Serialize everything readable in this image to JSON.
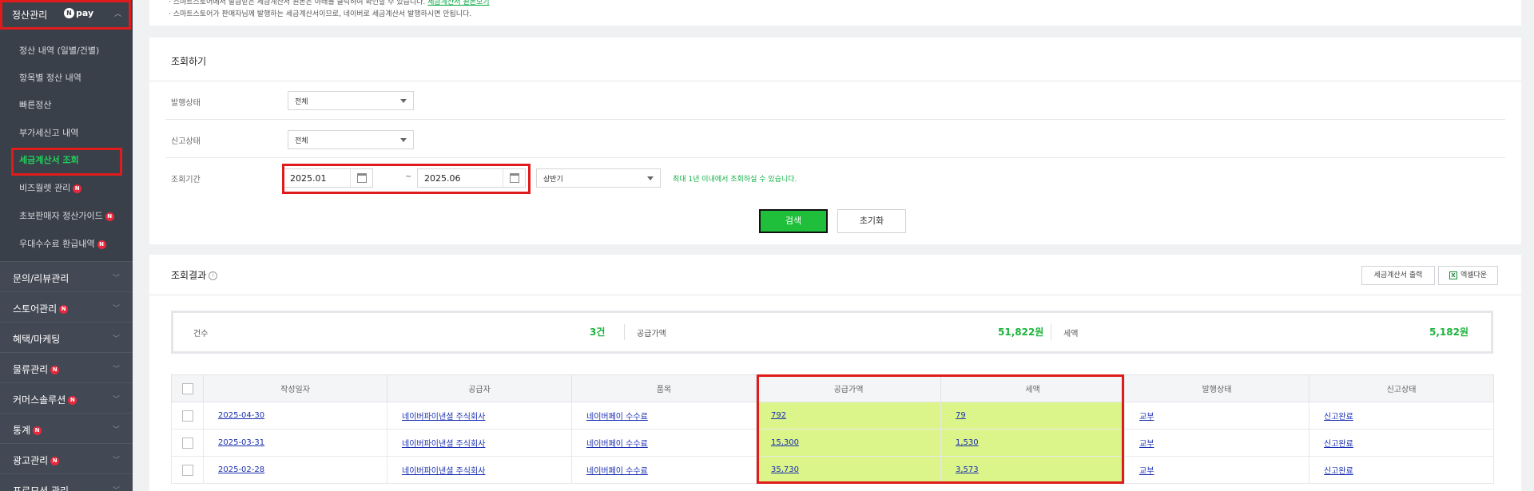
{
  "sidebar": {
    "top_title": "정산관리",
    "npay_label": "pay",
    "sub_items": [
      {
        "label": "정산 내역 (일별/건별)",
        "badge": ""
      },
      {
        "label": "항목별 정산 내역",
        "badge": ""
      },
      {
        "label": "빠른정산",
        "badge": ""
      },
      {
        "label": "부가세신고 내역",
        "badge": ""
      },
      {
        "label": "세금계산서 조회",
        "badge": ""
      },
      {
        "label": "비즈월렛 관리",
        "badge": "N"
      },
      {
        "label": "초보판매자 정산가이드",
        "badge": "N"
      },
      {
        "label": "우대수수료 환급내역",
        "badge": "N"
      }
    ],
    "menus": [
      {
        "label": "문의/리뷰관리",
        "badge": ""
      },
      {
        "label": "스토어관리",
        "badge": "N"
      },
      {
        "label": "혜택/마케팅",
        "badge": ""
      },
      {
        "label": "물류관리",
        "badge": "N"
      },
      {
        "label": "커머스솔루션",
        "badge": "N"
      },
      {
        "label": "통계",
        "badge": "N"
      },
      {
        "label": "광고관리",
        "badge": "N"
      },
      {
        "label": "프로모션 관리",
        "badge": ""
      }
    ]
  },
  "notice": {
    "line1_text": "· 스마트스토어에서 발급받은 세금계산서 원본은 아래를 클릭하여 확인할 수 있습니다.",
    "line1_link": "세금계산서 원본보기",
    "line2": "· 스마트스토어가 판매자님께 발행하는 세금계산서이므로, 네이버로 세금계산서 발행하시면 안됩니다."
  },
  "search": {
    "title": "조회하기",
    "issue_status_label": "발행상태",
    "issue_status_value": "전체",
    "report_status_label": "신고상태",
    "report_status_value": "전체",
    "period_label": "조회기간",
    "date_from": "2025.01",
    "date_sep": "~",
    "date_to": "2025.06",
    "period_select": "상반기",
    "hint": "최대 1년 이내에서 조회하실 수 있습니다.",
    "search_btn": "검색",
    "reset_btn": "초기화"
  },
  "result": {
    "title": "조회결과",
    "info_icon": "i",
    "print_btn": "세금계산서 출력",
    "excel_btn": "엑셀다운",
    "excel_icon": "X",
    "summary": {
      "count_label": "건수",
      "count_value": "3건",
      "supply_label": "공급가액",
      "supply_value": "51,822원",
      "tax_label": "세액",
      "tax_value": "5,182원"
    },
    "columns": [
      "작성일자",
      "공급자",
      "품목",
      "공급가액",
      "세액",
      "발행상태",
      "신고상태"
    ],
    "rows": [
      {
        "date": "2025-04-30",
        "supplier": "네이버파이낸셜 주식회사",
        "item": "네이버페이 수수료",
        "supply": "792",
        "tax": "79",
        "issue": "교부",
        "report": "신고완료"
      },
      {
        "date": "2025-03-31",
        "supplier": "네이버파이낸셜 주식회사",
        "item": "네이버페이 수수료",
        "supply": "15,300",
        "tax": "1,530",
        "issue": "교부",
        "report": "신고완료"
      },
      {
        "date": "2025-02-28",
        "supplier": "네이버파이낸셜 주식회사",
        "item": "네이버페이 수수료",
        "supply": "35,730",
        "tax": "3,573",
        "issue": "교부",
        "report": "신고완료"
      }
    ]
  }
}
